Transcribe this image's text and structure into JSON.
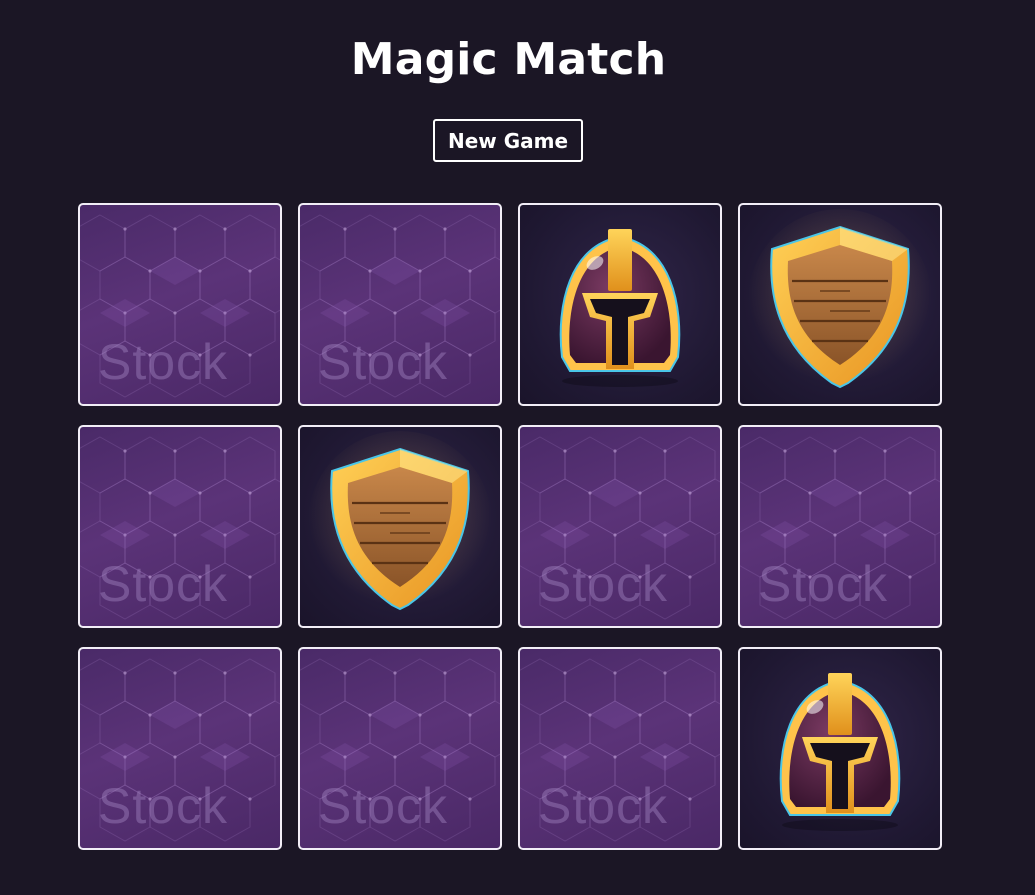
{
  "game": {
    "title": "Magic Match",
    "new_game_label": "New Game"
  },
  "board": {
    "columns": 4,
    "rows": 3,
    "cards": [
      {
        "state": "face-down",
        "back_text": "Stock"
      },
      {
        "state": "face-down",
        "back_text": "Stock"
      },
      {
        "state": "face-up",
        "icon": "helmet-icon"
      },
      {
        "state": "face-up",
        "icon": "shield-icon"
      },
      {
        "state": "face-down",
        "back_text": "Stock"
      },
      {
        "state": "face-up",
        "icon": "shield-icon"
      },
      {
        "state": "face-down",
        "back_text": "Stock"
      },
      {
        "state": "face-down",
        "back_text": "Stock"
      },
      {
        "state": "face-down",
        "back_text": "Stock"
      },
      {
        "state": "face-down",
        "back_text": "Stock"
      },
      {
        "state": "face-down",
        "back_text": "Stock"
      },
      {
        "state": "face-up",
        "icon": "helmet-icon"
      }
    ]
  },
  "colors": {
    "background": "#1b1625",
    "card_back": "#54306f",
    "card_border": "#f2eef7",
    "gold": "#f2ae2a",
    "helmet_dark": "#4a1f3c"
  }
}
